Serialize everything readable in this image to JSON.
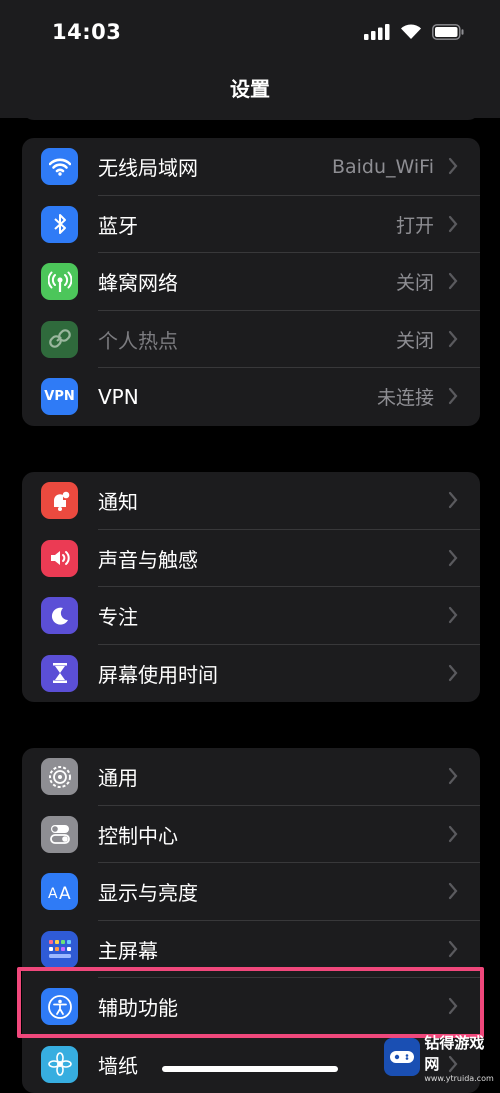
{
  "status": {
    "time": "14:03"
  },
  "nav": {
    "title": "设置"
  },
  "group1": [
    {
      "label": "Wi-Fi",
      "display": "无线局域网",
      "value": "Baidu_WiFi",
      "icon": "wifi-icon",
      "color": "#2f7bf6"
    },
    {
      "label": "蓝牙",
      "value": "打开",
      "icon": "bluetooth-icon",
      "color": "#2f7bf6"
    },
    {
      "label": "蜂窝网络",
      "value": "关闭",
      "icon": "cellular-icon",
      "color": "#4cc65a"
    },
    {
      "label": "个人热点",
      "value": "关闭",
      "icon": "hotspot-icon",
      "color": "#2f6a3c"
    },
    {
      "label": "VPN",
      "value": "未连接",
      "icon": "vpn-icon",
      "color": "#2f7bf6"
    }
  ],
  "group2": [
    {
      "label": "通知",
      "icon": "notification-icon",
      "color": "#eb4a3f"
    },
    {
      "label": "声音与触感",
      "icon": "sound-icon",
      "color": "#eb3b54"
    },
    {
      "label": "专注",
      "icon": "moon-icon",
      "color": "#5b4fd6"
    },
    {
      "label": "屏幕使用时间",
      "icon": "hourglass-icon",
      "color": "#5b4fd6"
    }
  ],
  "group3": [
    {
      "label": "通用",
      "icon": "gear-icon",
      "color": "#8e8e93"
    },
    {
      "label": "控制中心",
      "icon": "control-center-icon",
      "color": "#8e8e93"
    },
    {
      "label": "显示与亮度",
      "icon": "display-icon",
      "color": "#2f7bf6"
    },
    {
      "label": "主屏幕",
      "icon": "home-screen-icon",
      "color": "#2f5bd6"
    },
    {
      "label": "辅助功能",
      "icon": "accessibility-icon",
      "color": "#2f7bf6"
    },
    {
      "label": "墙纸",
      "icon": "wallpaper-icon",
      "color": "#37aee0"
    }
  ],
  "watermark": {
    "line1": "钻得游戏网",
    "line2": "www.ytruida.com"
  },
  "colors": {
    "highlight": "#f0487c"
  }
}
